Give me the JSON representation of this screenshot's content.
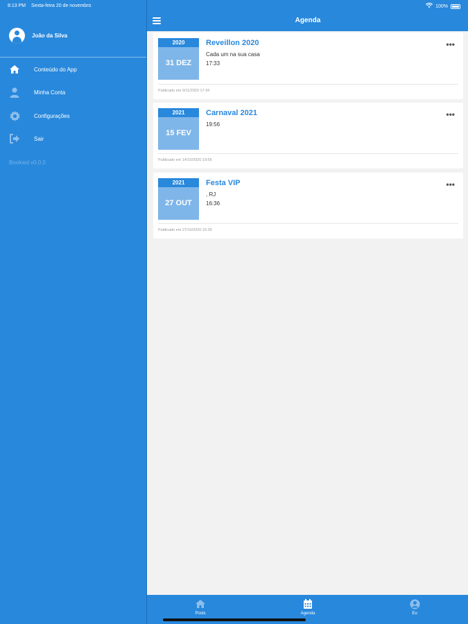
{
  "status": {
    "time": "8:13 PM",
    "date": "Sexta-feira 20 de novembro",
    "battery": "100%"
  },
  "sidebar": {
    "user_name": "João da Silva",
    "items": [
      {
        "label": "Conteúdo do App",
        "icon": "home-icon"
      },
      {
        "label": "Minha Conta",
        "icon": "user-icon"
      },
      {
        "label": "Configurações",
        "icon": "gear-icon"
      },
      {
        "label": "Sair",
        "icon": "sign-out-icon"
      }
    ],
    "version": "Bookied v0.0.0"
  },
  "header": {
    "title": "Agenda",
    "menu_icon": "hamburger-icon"
  },
  "events": [
    {
      "year": "2020",
      "day": "31 DEZ",
      "title": "Reveillon 2020",
      "lines": [
        "Cada um na sua casa",
        "17:33"
      ],
      "published": "Publicado em 9/11/2020 17:34"
    },
    {
      "year": "2021",
      "day": "15 FEV",
      "title": "Carnaval 2021",
      "lines": [
        "19:56"
      ],
      "published": "Publicado em 14/10/2020 19:56"
    },
    {
      "year": "2021",
      "day": "27 OUT",
      "title": "Festa VIP",
      "lines": [
        ", RJ",
        "16:36"
      ],
      "published": "Publicado em 27/10/2020 16:36"
    }
  ],
  "tabs": [
    {
      "label": "Posts",
      "icon": "home-icon"
    },
    {
      "label": "Agenda",
      "icon": "calendar-icon"
    },
    {
      "label": "Eu",
      "icon": "user-circle-icon"
    }
  ],
  "colors": {
    "primary": "#2888dc",
    "date_box": "#7fb6e9",
    "background": "#f2f2f2"
  }
}
